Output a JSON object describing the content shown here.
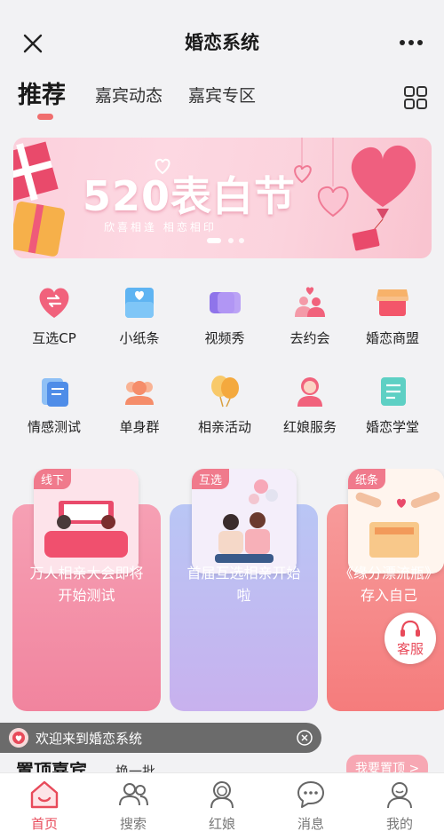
{
  "app": {
    "title": "婚恋系统"
  },
  "tabs": [
    {
      "label": "推荐",
      "active": true
    },
    {
      "label": "嘉宾动态",
      "active": false
    },
    {
      "label": "嘉宾专区",
      "active": false
    }
  ],
  "banner": {
    "title": "520表白节",
    "subtitle": "欣喜相逢 相恋相印",
    "slide_count": 3,
    "active_slide": 1
  },
  "grid": [
    {
      "label": "互选CP",
      "icon": "heart-swap-icon"
    },
    {
      "label": "小纸条",
      "icon": "note-icon"
    },
    {
      "label": "视频秀",
      "icon": "video-icon"
    },
    {
      "label": "去约会",
      "icon": "couple-icon"
    },
    {
      "label": "婚恋商盟",
      "icon": "shop-icon"
    },
    {
      "label": "情感测试",
      "icon": "test-icon"
    },
    {
      "label": "单身群",
      "icon": "group-icon"
    },
    {
      "label": "相亲活动",
      "icon": "balloon-icon"
    },
    {
      "label": "红娘服务",
      "icon": "matchmaker-icon"
    },
    {
      "label": "婚恋学堂",
      "icon": "book-icon"
    }
  ],
  "cards": [
    {
      "tag": "线下",
      "text": "万人相亲大会即将开始测试"
    },
    {
      "tag": "互选",
      "text": "首届互选相亲开始啦"
    },
    {
      "tag": "纸条",
      "text": "《缘分漂流瓶》存入自己"
    }
  ],
  "kefu": {
    "label": "客服"
  },
  "welcome": {
    "text": "欢迎来到婚恋系统"
  },
  "section": {
    "title": "置顶嘉宾",
    "refresh": "换一批",
    "button": "我要置顶 >"
  },
  "nav": [
    {
      "label": "首页",
      "icon": "home-icon",
      "active": true
    },
    {
      "label": "搜索",
      "icon": "search-people-icon",
      "active": false
    },
    {
      "label": "红娘",
      "icon": "matchmaker-icon",
      "active": false
    },
    {
      "label": "消息",
      "icon": "message-icon",
      "active": false
    },
    {
      "label": "我的",
      "icon": "profile-icon",
      "active": false
    }
  ],
  "colors": {
    "accent": "#e84a5a",
    "tab_indicator": "#f06e6e",
    "card1": "#f38fa6",
    "card2": "#b9b7ef",
    "card3": "#f58c8c"
  }
}
